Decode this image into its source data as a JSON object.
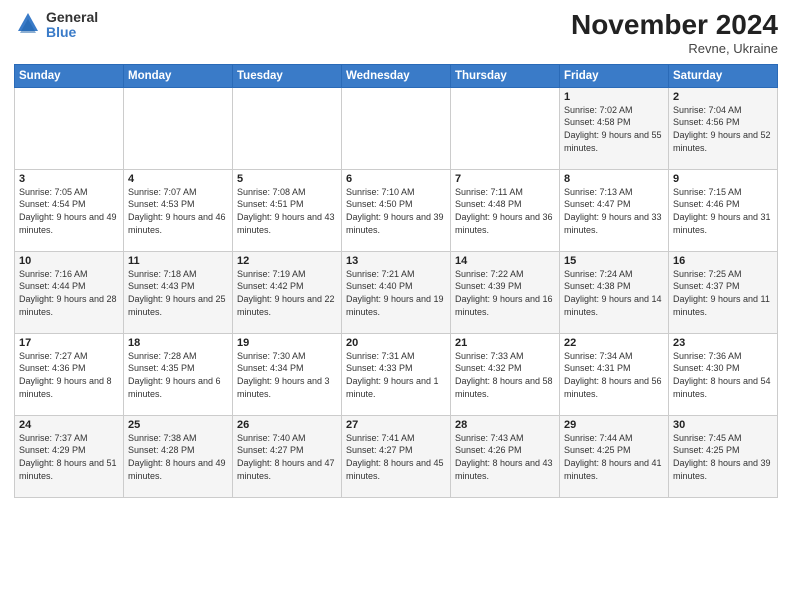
{
  "logo": {
    "text_top": "General",
    "text_bottom": "Blue"
  },
  "header": {
    "month": "November 2024",
    "location": "Revne, Ukraine"
  },
  "weekdays": [
    "Sunday",
    "Monday",
    "Tuesday",
    "Wednesday",
    "Thursday",
    "Friday",
    "Saturday"
  ],
  "weeks": [
    [
      {
        "day": "",
        "info": ""
      },
      {
        "day": "",
        "info": ""
      },
      {
        "day": "",
        "info": ""
      },
      {
        "day": "",
        "info": ""
      },
      {
        "day": "",
        "info": ""
      },
      {
        "day": "1",
        "info": "Sunrise: 7:02 AM\nSunset: 4:58 PM\nDaylight: 9 hours and 55 minutes."
      },
      {
        "day": "2",
        "info": "Sunrise: 7:04 AM\nSunset: 4:56 PM\nDaylight: 9 hours and 52 minutes."
      }
    ],
    [
      {
        "day": "3",
        "info": "Sunrise: 7:05 AM\nSunset: 4:54 PM\nDaylight: 9 hours and 49 minutes."
      },
      {
        "day": "4",
        "info": "Sunrise: 7:07 AM\nSunset: 4:53 PM\nDaylight: 9 hours and 46 minutes."
      },
      {
        "day": "5",
        "info": "Sunrise: 7:08 AM\nSunset: 4:51 PM\nDaylight: 9 hours and 43 minutes."
      },
      {
        "day": "6",
        "info": "Sunrise: 7:10 AM\nSunset: 4:50 PM\nDaylight: 9 hours and 39 minutes."
      },
      {
        "day": "7",
        "info": "Sunrise: 7:11 AM\nSunset: 4:48 PM\nDaylight: 9 hours and 36 minutes."
      },
      {
        "day": "8",
        "info": "Sunrise: 7:13 AM\nSunset: 4:47 PM\nDaylight: 9 hours and 33 minutes."
      },
      {
        "day": "9",
        "info": "Sunrise: 7:15 AM\nSunset: 4:46 PM\nDaylight: 9 hours and 31 minutes."
      }
    ],
    [
      {
        "day": "10",
        "info": "Sunrise: 7:16 AM\nSunset: 4:44 PM\nDaylight: 9 hours and 28 minutes."
      },
      {
        "day": "11",
        "info": "Sunrise: 7:18 AM\nSunset: 4:43 PM\nDaylight: 9 hours and 25 minutes."
      },
      {
        "day": "12",
        "info": "Sunrise: 7:19 AM\nSunset: 4:42 PM\nDaylight: 9 hours and 22 minutes."
      },
      {
        "day": "13",
        "info": "Sunrise: 7:21 AM\nSunset: 4:40 PM\nDaylight: 9 hours and 19 minutes."
      },
      {
        "day": "14",
        "info": "Sunrise: 7:22 AM\nSunset: 4:39 PM\nDaylight: 9 hours and 16 minutes."
      },
      {
        "day": "15",
        "info": "Sunrise: 7:24 AM\nSunset: 4:38 PM\nDaylight: 9 hours and 14 minutes."
      },
      {
        "day": "16",
        "info": "Sunrise: 7:25 AM\nSunset: 4:37 PM\nDaylight: 9 hours and 11 minutes."
      }
    ],
    [
      {
        "day": "17",
        "info": "Sunrise: 7:27 AM\nSunset: 4:36 PM\nDaylight: 9 hours and 8 minutes."
      },
      {
        "day": "18",
        "info": "Sunrise: 7:28 AM\nSunset: 4:35 PM\nDaylight: 9 hours and 6 minutes."
      },
      {
        "day": "19",
        "info": "Sunrise: 7:30 AM\nSunset: 4:34 PM\nDaylight: 9 hours and 3 minutes."
      },
      {
        "day": "20",
        "info": "Sunrise: 7:31 AM\nSunset: 4:33 PM\nDaylight: 9 hours and 1 minute."
      },
      {
        "day": "21",
        "info": "Sunrise: 7:33 AM\nSunset: 4:32 PM\nDaylight: 8 hours and 58 minutes."
      },
      {
        "day": "22",
        "info": "Sunrise: 7:34 AM\nSunset: 4:31 PM\nDaylight: 8 hours and 56 minutes."
      },
      {
        "day": "23",
        "info": "Sunrise: 7:36 AM\nSunset: 4:30 PM\nDaylight: 8 hours and 54 minutes."
      }
    ],
    [
      {
        "day": "24",
        "info": "Sunrise: 7:37 AM\nSunset: 4:29 PM\nDaylight: 8 hours and 51 minutes."
      },
      {
        "day": "25",
        "info": "Sunrise: 7:38 AM\nSunset: 4:28 PM\nDaylight: 8 hours and 49 minutes."
      },
      {
        "day": "26",
        "info": "Sunrise: 7:40 AM\nSunset: 4:27 PM\nDaylight: 8 hours and 47 minutes."
      },
      {
        "day": "27",
        "info": "Sunrise: 7:41 AM\nSunset: 4:27 PM\nDaylight: 8 hours and 45 minutes."
      },
      {
        "day": "28",
        "info": "Sunrise: 7:43 AM\nSunset: 4:26 PM\nDaylight: 8 hours and 43 minutes."
      },
      {
        "day": "29",
        "info": "Sunrise: 7:44 AM\nSunset: 4:25 PM\nDaylight: 8 hours and 41 minutes."
      },
      {
        "day": "30",
        "info": "Sunrise: 7:45 AM\nSunset: 4:25 PM\nDaylight: 8 hours and 39 minutes."
      }
    ]
  ]
}
